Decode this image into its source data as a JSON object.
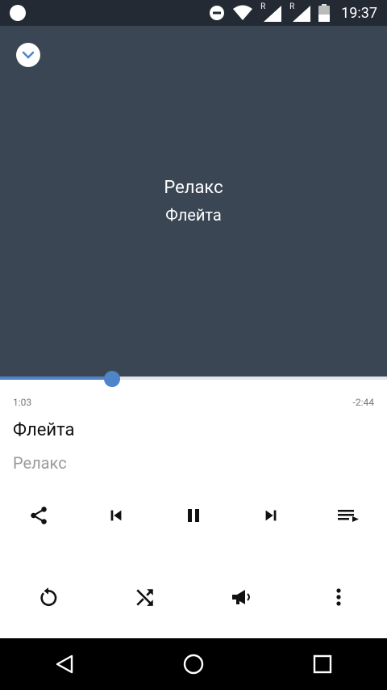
{
  "status_bar": {
    "time": "19:37",
    "icons": [
      "notification-dot-icon",
      "do-not-disturb-icon",
      "wifi-icon",
      "signal-roaming-icon",
      "signal-roaming-icon",
      "battery-icon"
    ],
    "roaming_label": "R"
  },
  "artwork": {
    "album": "Релакс",
    "title": "Флейта",
    "background_color": "#3a4654"
  },
  "player": {
    "elapsed": "1:03",
    "remaining": "-2:44",
    "progress_fraction": 0.29,
    "title": "Флейта",
    "artist": "Релакс",
    "accent_color": "#4f84c8"
  },
  "controls": {
    "row1": [
      "share-icon",
      "previous-icon",
      "pause-icon",
      "next-icon",
      "queue-icon"
    ],
    "row2": [
      "repeat-icon",
      "shuffle-icon",
      "broadcast-icon",
      "more-icon"
    ]
  },
  "nav_bar": [
    "back-icon",
    "home-icon",
    "recents-icon"
  ]
}
